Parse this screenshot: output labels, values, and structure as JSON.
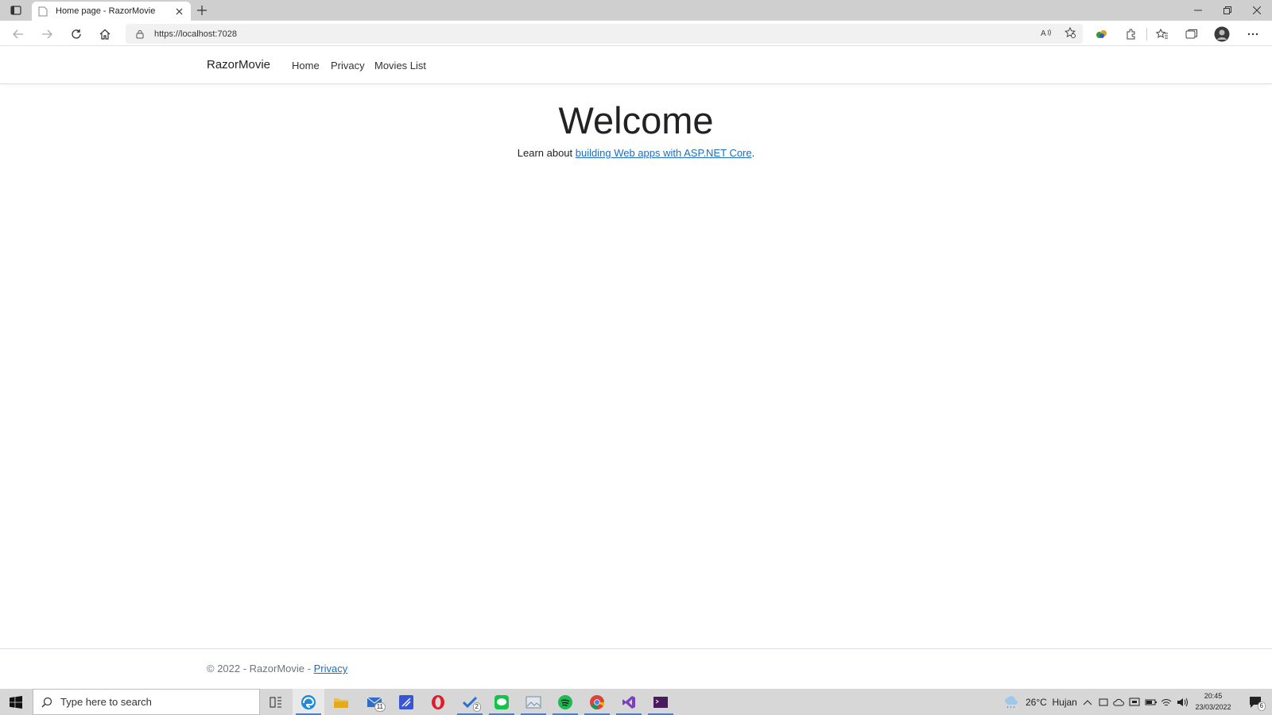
{
  "browser": {
    "tab_title": "Home page - RazorMovie",
    "url": "https://localhost:7028"
  },
  "site": {
    "brand": "RazorMovie",
    "nav": [
      "Home",
      "Privacy",
      "Movies List"
    ],
    "welcome": "Welcome",
    "learn_prefix": "Learn about ",
    "learn_link": "building Web apps with ASP.NET Core",
    "learn_suffix": ".",
    "footer_text": "© 2022 - RazorMovie - ",
    "footer_link": "Privacy"
  },
  "taskbar": {
    "search_placeholder": "Type here to search",
    "mail_badge": "11",
    "todo_badge": "2",
    "weather": "26°C  Hujan",
    "time": "20:45",
    "date": "23/03/2022",
    "notification_count": "6"
  },
  "colors": {
    "link": "#1b6ec2",
    "taskbar": "#d7d7d7",
    "tabstrip": "#cfcfcf"
  }
}
